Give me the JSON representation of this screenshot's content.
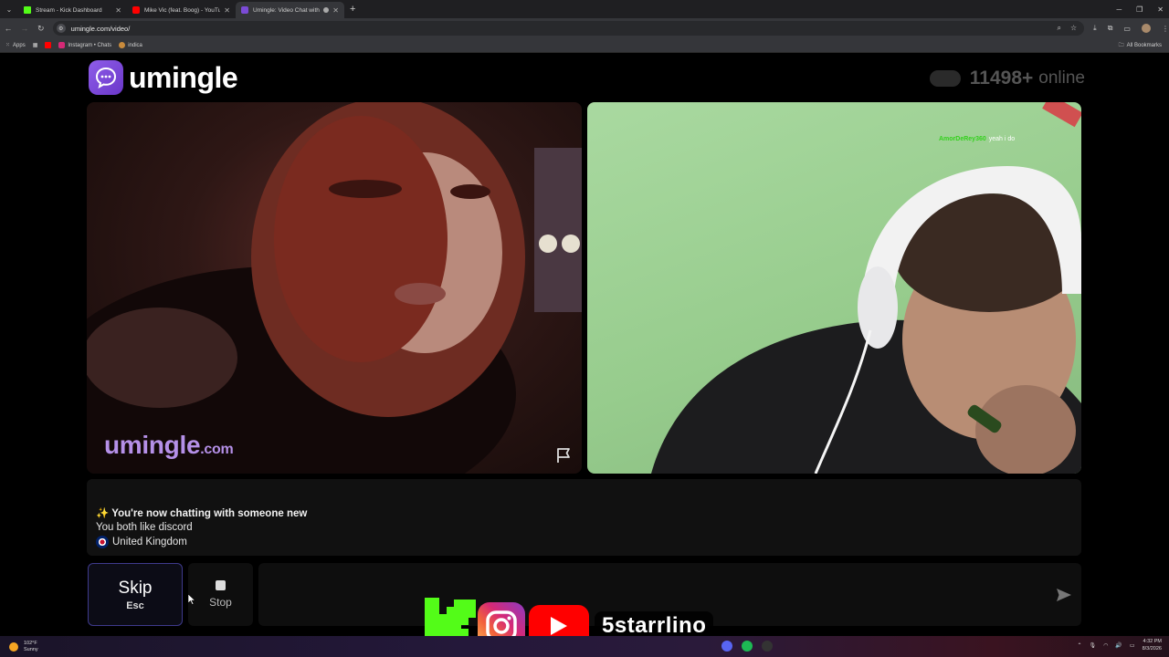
{
  "browser": {
    "tabs": [
      {
        "label": "Stream - Kick Dashboard",
        "favicon": "kick-icon",
        "active": false
      },
      {
        "label": "Mike Vic (feat. Boog) - YouTube",
        "favicon": "youtube-icon",
        "active": false
      },
      {
        "label": "Umingle: Video Chat with S",
        "favicon": "umingle-icon",
        "active": true
      }
    ],
    "url": "umingle.com/video/",
    "bookmarks": [
      {
        "label": "Apps",
        "icon": "apps-grid-icon"
      },
      {
        "label": "",
        "icon": "youtube-icon"
      },
      {
        "label": "Instagram • Chats",
        "icon": "instagram-icon"
      },
      {
        "label": "indica",
        "icon": "leaf-icon"
      }
    ],
    "all_bookmarks_label": "All Bookmarks"
  },
  "site": {
    "logo_text": "umingle",
    "online_count": "11498+",
    "online_label": "online"
  },
  "video": {
    "watermark_main": "umingle",
    "watermark_suffix": ".com",
    "chat_overlay_user": "AmorDeRey360",
    "chat_overlay_message": "yeah i do"
  },
  "chat": {
    "line1": "✨ You're now chatting with someone new",
    "line2": "You both like discord",
    "line3": "United Kingdom"
  },
  "controls": {
    "skip_label": "Skip",
    "skip_key": "Esc",
    "stop_label": "Stop",
    "message_placeholder": ""
  },
  "overlay": {
    "handle": "5starrlino"
  },
  "taskbar": {
    "temperature": "102°F",
    "weather": "Sunny",
    "time": "4:32 PM",
    "date": "8/3/2026"
  },
  "colors": {
    "brand_purple": "#7b4bd6",
    "kick_green": "#53fc18",
    "youtube_red": "#ff0000",
    "chat_user_green": "#34d11e"
  }
}
